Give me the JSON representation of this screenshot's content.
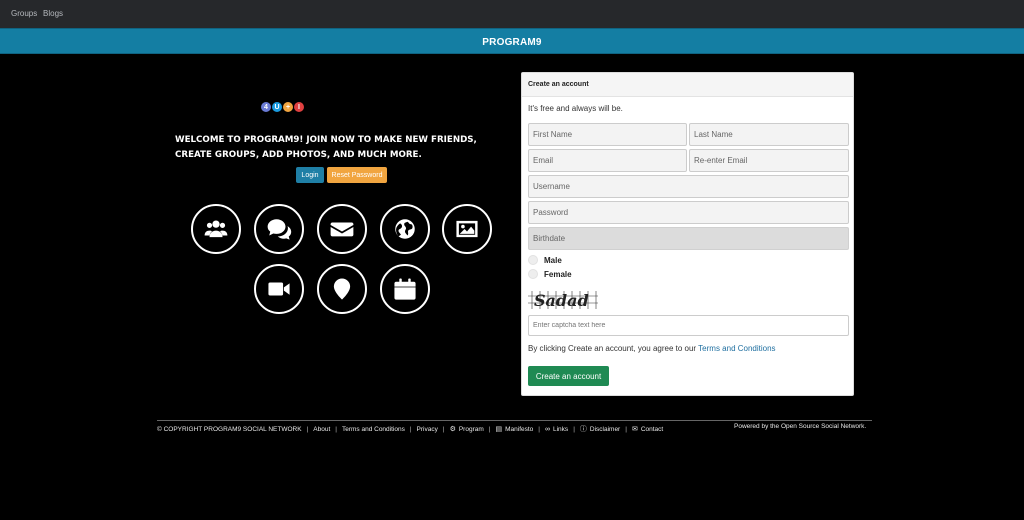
{
  "topnav": {
    "groups": "Groups",
    "blogs": "Blogs"
  },
  "banner": {
    "title": "PROGRAM9"
  },
  "logo": {
    "letters": [
      "4",
      "U",
      "+",
      "I"
    ],
    "colors": [
      "#6a7bd6",
      "#1a9be0",
      "#f1a540",
      "#e04040"
    ]
  },
  "hero": {
    "welcome": "WELCOME TO PROGRAM9! JOIN NOW TO MAKE NEW FRIENDS, CREATE GROUPS, ADD PHOTOS, AND MUCH MORE.",
    "login_label": "Login",
    "reset_label": "Reset Password"
  },
  "features": [
    "users-icon",
    "comments-icon",
    "envelope-icon",
    "globe-icon",
    "image-icon",
    "video-icon",
    "map-marker-icon",
    "calendar-icon"
  ],
  "signup": {
    "header": "Create an account",
    "subtitle": "It's free and always will be.",
    "first_name_placeholder": "First Name",
    "last_name_placeholder": "Last Name",
    "email_placeholder": "Email",
    "reenter_email_placeholder": "Re-enter Email",
    "username_placeholder": "Username",
    "password_placeholder": "Password",
    "birthdate_placeholder": "Birthdate",
    "male_label": "Male",
    "female_label": "Female",
    "captcha_text": "Sadad",
    "captcha_placeholder": "Enter captcha text here",
    "agree_text": "By clicking Create an account, you agree to our ",
    "terms_link": "Terms and Conditions",
    "create_label": "Create an account"
  },
  "footer": {
    "copyright": "© COPYRIGHT PROGRAM9 SOCIAL NETWORK",
    "about": "About",
    "terms": "Terms and Conditions",
    "privacy": "Privacy",
    "program": "Program",
    "manifesto": "Manifesto",
    "links": "Links",
    "disclaimer": "Disclaimer",
    "contact": "Contact",
    "powered": "Powered by the Open Source Social Network."
  },
  "colors": {
    "banner": "#147ea3",
    "login": "#1f7fa6",
    "reset": "#f1a540",
    "create": "#1f8a53"
  }
}
